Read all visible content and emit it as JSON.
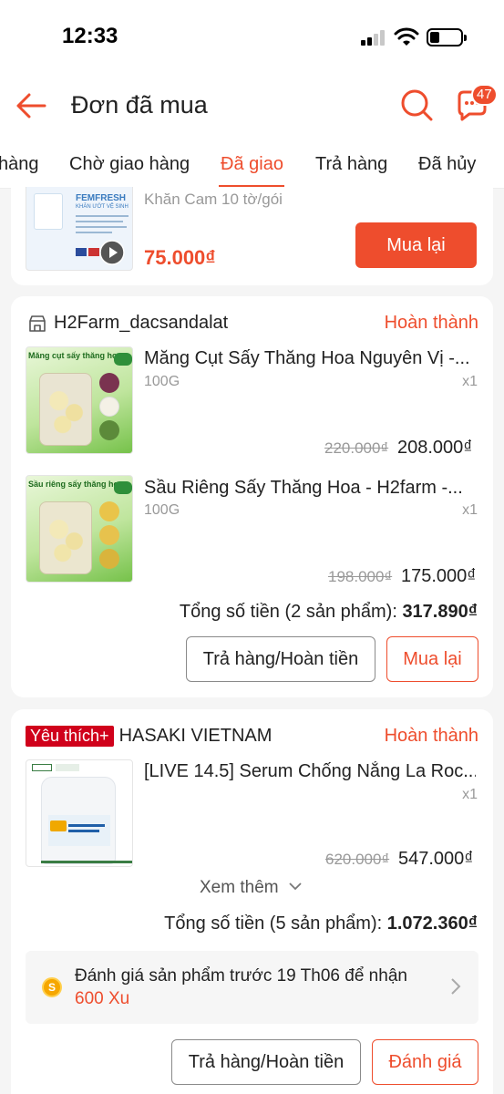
{
  "status_bar": {
    "time": "12:33"
  },
  "header": {
    "title": "Đơn đã mua",
    "chat_badge": "47"
  },
  "tabs": [
    {
      "label": "hàng"
    },
    {
      "label": "Chờ giao hàng"
    },
    {
      "label": "Đã giao",
      "active": true
    },
    {
      "label": "Trả hàng"
    },
    {
      "label": "Đã hủy"
    }
  ],
  "order1": {
    "product_brand": "FEMFRESH",
    "product_brand_sub": "KHĂN ƯỚT VỆ SINH",
    "variant": "Khăn Cam 10 tờ/gói",
    "price": "75.000₫",
    "action": "Mua lại"
  },
  "order2": {
    "shop": "H2Farm_dacsandalat",
    "status": "Hoàn thành",
    "items": [
      {
        "image_label": "Măng cụt sấy thăng hoa",
        "name": "Măng Cụt Sấy Thăng Hoa Nguyên Vị -...",
        "variant": "100G",
        "qty": "x1",
        "price_old": "220.000₫",
        "price_new": "208.000₫"
      },
      {
        "image_label": "Sầu riêng sấy thăng hoa",
        "name": "Sầu Riêng Sấy Thăng Hoa - H2farm -...",
        "variant": "100G",
        "qty": "x1",
        "price_old": "198.000₫",
        "price_new": "175.000₫"
      }
    ],
    "total_label": "Tổng số tiền (2 sản phẩm):",
    "total_value": "317.890₫",
    "btn_return": "Trả hàng/Hoàn tiền",
    "btn_rebuy": "Mua lại"
  },
  "order3": {
    "fav_badge": "Yêu thích+",
    "shop": "HASAKI VIETNAM",
    "status": "Hoàn thành",
    "item": {
      "name": "[LIVE 14.5] Serum Chống Nắng La Roc...",
      "qty": "x1",
      "price_old": "620.000₫",
      "price_new": "547.000₫"
    },
    "see_more": "Xem thêm",
    "total_label": "Tổng số tiền (5 sản phẩm):",
    "total_value": "1.072.360₫",
    "review_text": "Đánh giá sản phẩm trước 19 Th06 để nhận",
    "review_reward": "600 Xu",
    "btn_return": "Trả hàng/Hoàn tiền",
    "btn_review": "Đánh giá"
  },
  "colors": {
    "accent": "#ee4d2d",
    "background": "#f5f5f5",
    "muted": "#999999"
  }
}
